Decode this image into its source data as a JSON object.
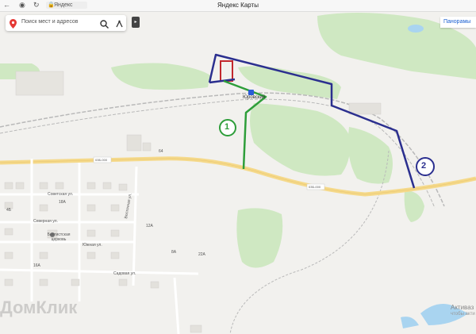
{
  "browser": {
    "url_text": "Яндекс",
    "title": "Яндекс Карты",
    "back_icon": "arrow-left-icon",
    "refresh_icon": "refresh-icon"
  },
  "search": {
    "placeholder": "Поиск мест и адресов",
    "pin_icon": "map-pin-icon",
    "search_icon": "search-icon",
    "route_icon": "route-icon"
  },
  "panorama_button": {
    "label": "Панорамы"
  },
  "map": {
    "station_label": "Юровский",
    "street_labels": {
      "sovetskaya": "Советская ул.",
      "severnaya": "Северная ул.",
      "vostochnaya": "Восточная ул.",
      "yuzhnaya": "Южная ул.",
      "sadovaya": "Садовая ул."
    },
    "church_label": "Баптистская церковь",
    "road_badges": [
      "03Б-000",
      "03Б-000"
    ],
    "house_numbers": [
      "64",
      "18А",
      "12А",
      "22А",
      "16А",
      "4Б",
      "8А"
    ],
    "markers": [
      {
        "label": "1",
        "color": "#2e9e3a"
      },
      {
        "label": "2",
        "color": "#2b2f8f"
      }
    ],
    "watermark": "ДомКлик",
    "side_label": "Активаз",
    "side_label_sub": "чтобы акти"
  }
}
